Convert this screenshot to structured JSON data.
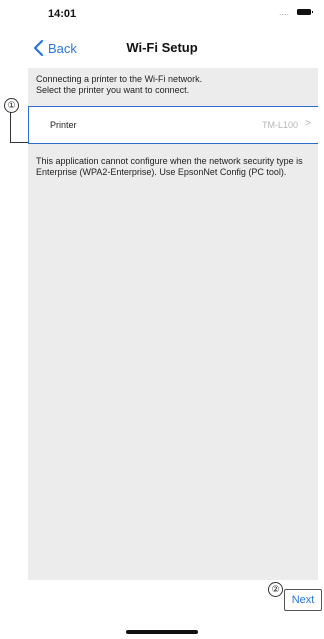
{
  "status_bar": {
    "time": "14:01",
    "signal": "....",
    "battery_icon": "battery-icon"
  },
  "nav": {
    "back_label": "Back",
    "back_icon": "chevron-left-icon",
    "title": "Wi-Fi Setup"
  },
  "content": {
    "instruction_line1": "Connecting a printer to the Wi-Fi network.",
    "instruction_line2": "Select the printer you want to connect.",
    "printer_row": {
      "label": "Printer",
      "value": "TM-L100",
      "chevron": ">"
    },
    "note": "This application cannot configure when the network security type is Enterprise (WPA2-Enterprise). Use EpsonNet Config (PC tool)."
  },
  "callouts": {
    "one": "①",
    "two": "②"
  },
  "footer": {
    "next_label": "Next"
  },
  "colors": {
    "accent": "#2a76d8",
    "content_bg": "#ececec",
    "row_border": "#2e6bd0"
  }
}
